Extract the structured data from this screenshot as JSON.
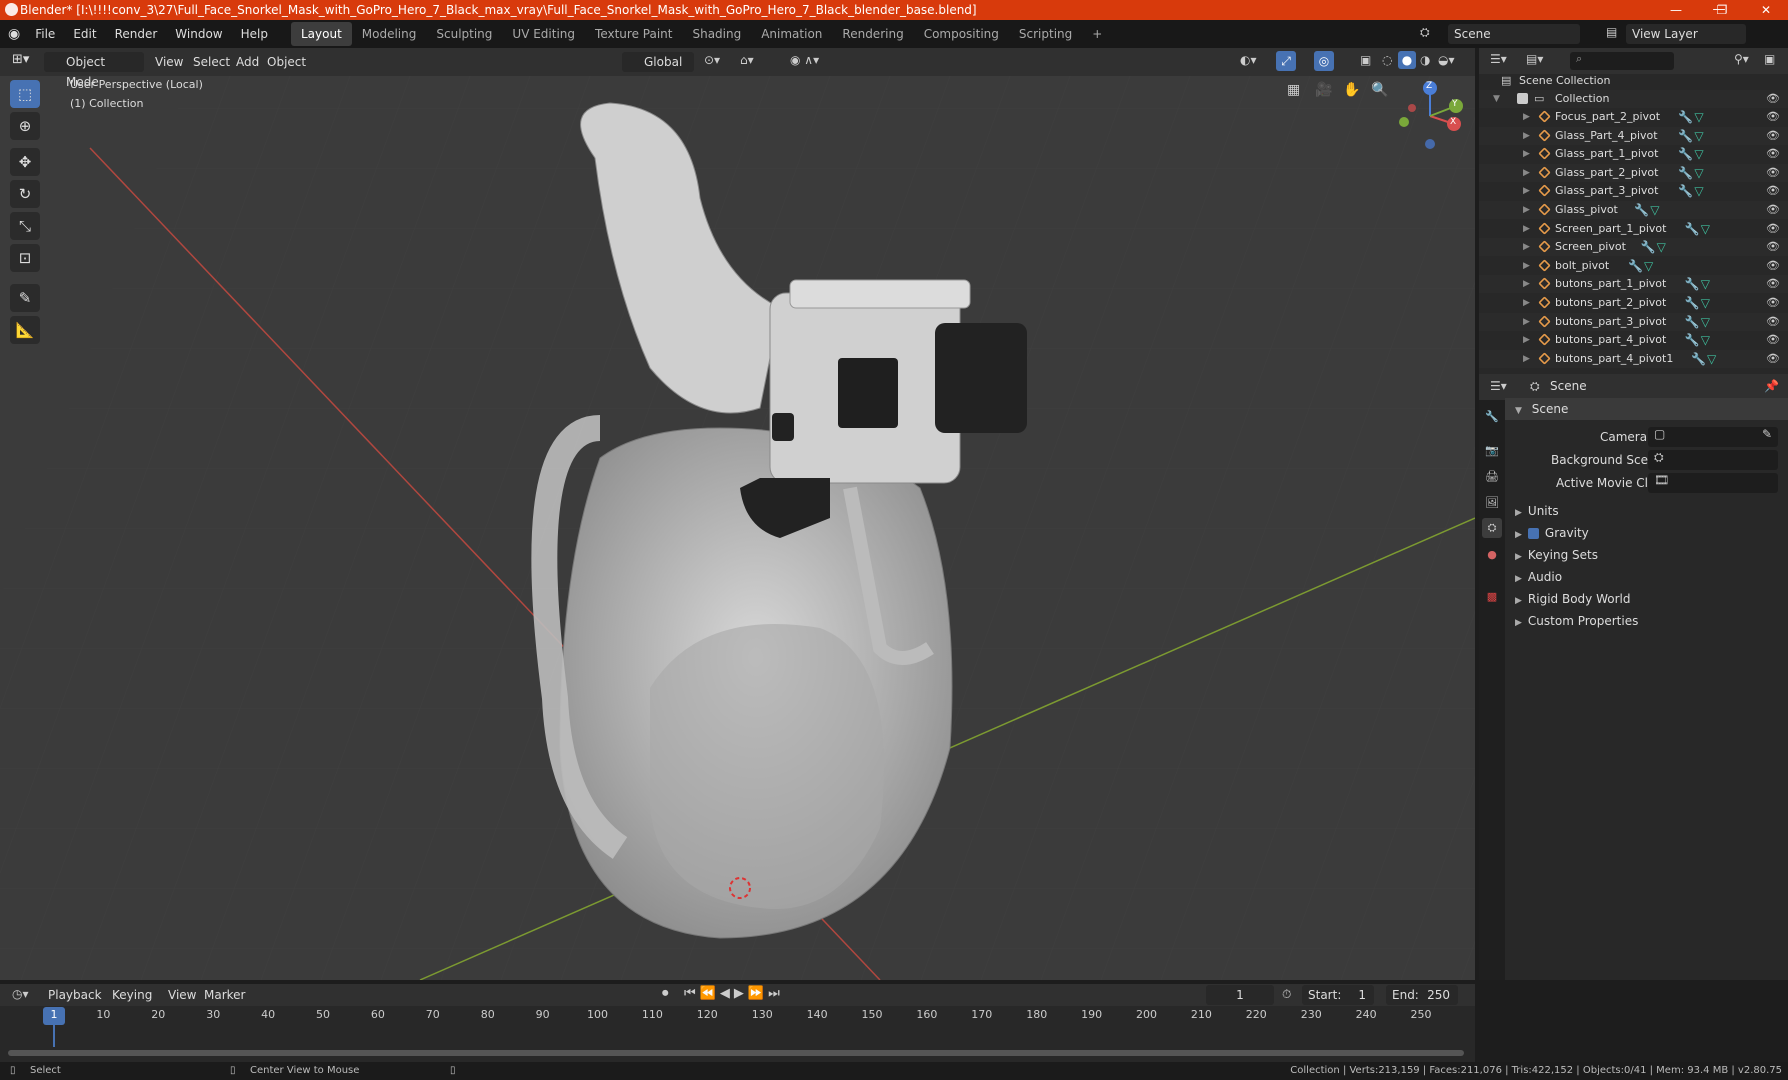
{
  "titlebar": {
    "title": "Blender* [I:\\!!!!conv_3\\27\\Full_Face_Snorkel_Mask_with_GoPro_Hero_7_Black_max_vray\\Full_Face_Snorkel_Mask_with_GoPro_Hero_7_Black_blender_base.blend]",
    "min": "—",
    "max": "❐",
    "close": "✕"
  },
  "menubar": {
    "items": [
      "File",
      "Edit",
      "Render",
      "Window",
      "Help"
    ],
    "workspaces": [
      "Layout",
      "Modeling",
      "Sculpting",
      "UV Editing",
      "Texture Paint",
      "Shading",
      "Animation",
      "Rendering",
      "Compositing",
      "Scripting"
    ],
    "add_workspace": "+",
    "scene": "Scene",
    "view_layer": "View Layer"
  },
  "viewport": {
    "mode": "Object Mode",
    "menus": [
      "View",
      "Select",
      "Add",
      "Object"
    ],
    "transform_orientation": "Global",
    "overlay_line1": "User Perspective (Local)",
    "overlay_line2": "(1) Collection",
    "gizmo": {
      "x": "X",
      "y": "Y",
      "z": "Z"
    }
  },
  "outliner": {
    "scene_collection": "Scene Collection",
    "collection": "Collection",
    "objects": [
      "Focus_part_2_pivot",
      "Glass_Part_4_pivot",
      "Glass_part_1_pivot",
      "Glass_part_2_pivot",
      "Glass_part_3_pivot",
      "Glass_pivot",
      "Screen_part_1_pivot",
      "Screen_pivot",
      "bolt_pivot",
      "butons_part_1_pivot",
      "butons_part_2_pivot",
      "butons_part_3_pivot",
      "butons_part_4_pivot",
      "butons_part_4_pivot1"
    ]
  },
  "properties": {
    "header": "Scene",
    "panel": "Scene",
    "camera_label": "Camera",
    "background_scene_label": "Background Scene",
    "active_movie_clip_label": "Active Movie Clip",
    "subpanels": [
      "Units",
      "Gravity",
      "Keying Sets",
      "Audio",
      "Rigid Body World",
      "Custom Properties"
    ]
  },
  "timeline": {
    "menus": [
      "Playback",
      "Keying",
      "View",
      "Marker"
    ],
    "current_frame": "1",
    "start_label": "Start:",
    "start": "1",
    "end_label": "End:",
    "end": "250",
    "ticks": [
      "1",
      "10",
      "20",
      "30",
      "40",
      "50",
      "60",
      "70",
      "80",
      "90",
      "100",
      "110",
      "120",
      "130",
      "140",
      "150",
      "160",
      "170",
      "180",
      "190",
      "200",
      "210",
      "220",
      "230",
      "240",
      "250"
    ]
  },
  "statusbar": {
    "select": "Select",
    "center_view": "Center View to Mouse",
    "stats": "Collection | Verts:213,159 | Faces:211,076 | Tris:422,152 | Objects:0/41 | Mem: 93.4 MB | v2.80.75"
  },
  "colors": {
    "titlebar": "#d83a0c",
    "accent": "#4772b3",
    "object_icon": "#e59a4a",
    "mesh_icon": "#3fbf9e"
  }
}
